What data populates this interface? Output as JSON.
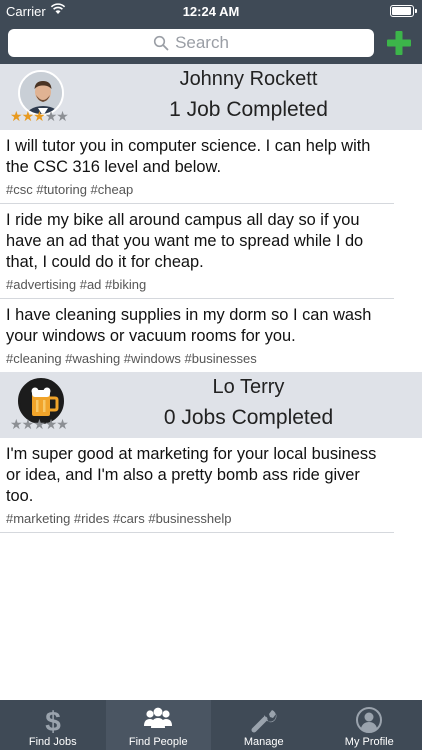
{
  "status_bar": {
    "carrier": "Carrier",
    "time": "12:24 AM",
    "battery_level": 1.0
  },
  "search": {
    "placeholder": "Search"
  },
  "people": [
    {
      "name": "Johnny Rockett",
      "jobs_completed": "1 Job Completed",
      "rating": 2.5,
      "avatar": "person-photo",
      "posts": [
        {
          "description": "I will tutor you in computer science. I can help with the CSC 316 level and below.",
          "tags": "#csc #tutoring #cheap"
        },
        {
          "description": "I ride my bike all around campus all day so if you have an ad that you want me to spread while I do that, I could do it for cheap.",
          "tags": "#advertising #ad #biking"
        },
        {
          "description": "I have cleaning supplies in my dorm so I can wash your windows or vacuum rooms for you.",
          "tags": "#cleaning #washing #windows #businesses"
        }
      ]
    },
    {
      "name": "Lo Terry",
      "jobs_completed": "0 Jobs Completed",
      "rating": 0,
      "avatar": "beer-mug-icon",
      "posts": [
        {
          "description": "I'm super good at marketing for your local business or idea, and I'm also a pretty bomb ass ride giver too.",
          "tags": "#marketing #rides #cars #businesshelp"
        }
      ]
    }
  ],
  "tabs": [
    {
      "label": "Find Jobs",
      "icon": "dollar-icon",
      "active": false
    },
    {
      "label": "Find People",
      "icon": "people-icon",
      "active": true
    },
    {
      "label": "Manage",
      "icon": "wrench-icon",
      "active": false
    },
    {
      "label": "My Profile",
      "icon": "profile-icon",
      "active": false
    }
  ],
  "colors": {
    "header": "#3f4a56",
    "section_bg": "#dfe2e8",
    "add_green": "#3cb54a",
    "star_on": "#e89a1f",
    "star_off": "#8c8f94"
  }
}
